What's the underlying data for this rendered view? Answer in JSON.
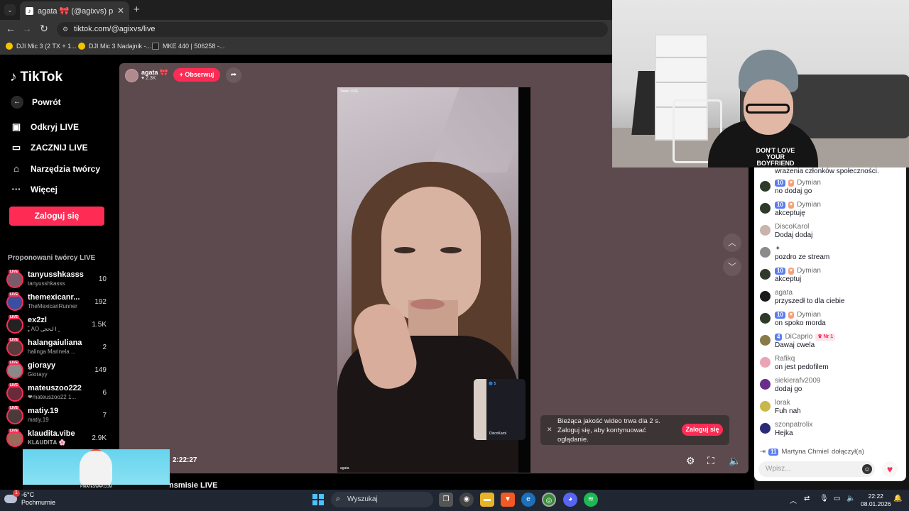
{
  "browser": {
    "tab_title": "agata 🎀 (@agixvs) prowad...",
    "url": "tiktok.com/@agixvs/live",
    "bookmarks": [
      "DJI Mic 3 (2 TX + 1...",
      "DJI Mic 3 Nadajnik -...",
      "MKE 440 | 506258 -..."
    ]
  },
  "sidebar": {
    "logo": "TikTok",
    "back": "Powrót",
    "items": [
      "Odkryj LIVE",
      "ZACZNIJ LIVE",
      "Narzędzia twórcy",
      "Więcej"
    ],
    "login": "Zaloguj się",
    "suggested_title": "Proponowani twórcy LIVE",
    "creators": [
      {
        "name": "tanyusshkasss",
        "sub": "tanyusshkasss",
        "count": "10"
      },
      {
        "name": "themexicanr...",
        "sub": "TheMexicanRunner",
        "count": "192"
      },
      {
        "name": "ex2zl",
        "sub": "ـًٍَ AO ﮼الحجي",
        "count": "1.5K"
      },
      {
        "name": "halangaiuliana",
        "sub": "halinga Marinela ...",
        "count": "2"
      },
      {
        "name": "giorayy",
        "sub": "Giorayy",
        "count": "149"
      },
      {
        "name": "mateuszoo222",
        "sub": "❤mateuszoo22 1...",
        "count": "6"
      },
      {
        "name": "matiy.19",
        "sub": "matiy.19",
        "count": "7"
      },
      {
        "name": "klaudita.vibe",
        "sub": "𝐊𝐋𝐀𝐔𝐃𝐈𝐓𝐀 🌸",
        "count": "2.9K"
      }
    ]
  },
  "live": {
    "host_name": "agata 🎀",
    "host_likes": "♥ 2.3K",
    "follow": "+ Obserwuj",
    "video_tag": "Twinn LIVE",
    "pip_name": "DiscoKarol",
    "pip_badge": "🔵 5",
    "timer": "2:22:27",
    "caption": "nsmisie LIVE",
    "notice": "Bieżąca jakość wideo trwa dla 2 s. Zaloguj się, aby kontynuować oglądanie.",
    "notice_btn": "Zaloguj się",
    "ad_text": "PIRATESWAP.COM"
  },
  "chat": {
    "top_text": "wrażenia członków społeczności.",
    "messages": [
      {
        "user": "Dymian",
        "lvl": "10",
        "heart": "♥",
        "text": "no dodaj go",
        "avatar": "#2f3b2a"
      },
      {
        "user": "Dymian",
        "lvl": "10",
        "heart": "♥",
        "text": "akceptuję",
        "avatar": "#2f3b2a"
      },
      {
        "user": "DiscoKarol",
        "text": "Dodaj dodaj",
        "avatar": "#c9b3ad"
      },
      {
        "user": "✦",
        "text": "pozdro ze stream",
        "avatar": "#8b8b8b"
      },
      {
        "user": "Dymian",
        "lvl": "10",
        "heart": "♥",
        "text": "akceptuj",
        "avatar": "#2f3b2a"
      },
      {
        "user": "agata",
        "text": "przyszedł to dla ciebie",
        "avatar": "#1a1a1a"
      },
      {
        "user": "Dymian",
        "lvl": "10",
        "heart": "♥",
        "text": "on spoko morda",
        "avatar": "#2f3b2a"
      },
      {
        "user": "DiCaprio",
        "lvl": "4",
        "nr1": "♛ Nr 1",
        "text": "Dawaj cwela",
        "avatar": "#8a7a4a"
      },
      {
        "user": "Rafikq",
        "text": "on jest pedofilem",
        "avatar": "#e8a5b5"
      },
      {
        "user": "siekierafv2009",
        "text": "dodaj go",
        "avatar": "#6a2c8a"
      },
      {
        "user": "lorak",
        "text": "Fuh nah",
        "avatar": "#c8b84a"
      },
      {
        "user": "szonpatrolix",
        "text": "Hejka",
        "avatar": "#2a2a7a"
      }
    ],
    "joined_lvl": "11",
    "joined_user": "Martyna Chmiel",
    "joined_text": "dołączył(a)",
    "input_placeholder": "Wpisz..."
  },
  "webcam": {
    "shirt_text": "DON'T LOVE YOUR BOYFRIEND"
  },
  "taskbar": {
    "temp": "-6°C",
    "weather": "Pochmurnie",
    "weather_badge": "1",
    "search": "Wyszukaj",
    "time": "22:22",
    "date": "08.01.2026"
  }
}
